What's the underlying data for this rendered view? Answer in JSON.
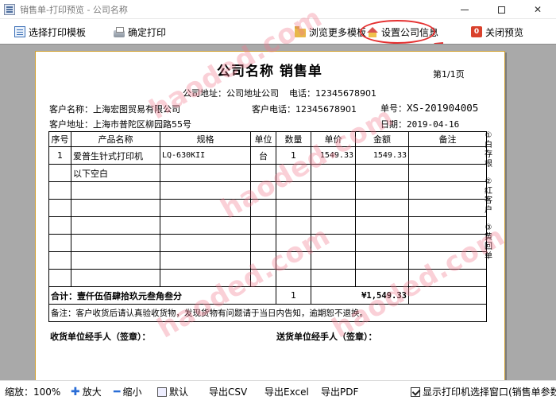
{
  "window": {
    "title": "销售单-打印预览 - 公司名称"
  },
  "toolbar": {
    "select_template": "选择打印模板",
    "confirm_print": "确定打印",
    "browse_templates": "浏览更多模板",
    "company_settings": "设置公司信息",
    "close_preview": "关闭预览"
  },
  "document": {
    "title": "公司名称  销售单",
    "page": "第1/1页",
    "company_address": "公司地址：公司地址公司",
    "company_phone": "电话：12345678901",
    "customer_name_label": "客户名称：",
    "customer_name": "上海宏图贸易有限公司",
    "customer_phone": "客户电话：12345678901",
    "order_no_label": "单号：",
    "order_no": "XS-201904005",
    "customer_addr_label": "客户地址：",
    "customer_addr": "上海市普陀区柳园路55号",
    "date_label": "日期：",
    "date": "2019-04-16",
    "columns": [
      "序号",
      "产品名称",
      "规格",
      "单位",
      "数量",
      "单价",
      "金额",
      "备注"
    ],
    "rows": [
      {
        "no": "1",
        "name": "爱普生针式打印机",
        "spec": "LQ-630KII",
        "unit": "台",
        "qty": "1",
        "price": "1549.33",
        "amount": "1549.33",
        "note": ""
      }
    ],
    "blank_note": "以下空白",
    "total_label": "合计：",
    "total_words": "壹仟伍佰肆拾玖元叁角叁分",
    "total_qty": "1",
    "total_amount": "¥1,549.33",
    "remark": "备注：客户收货后请认真验收货物，发现货物有问题请于当日内告知，逾期恕不退换。",
    "receiver_sign": "收货单位经手人（签章）：",
    "sender_sign": "送货单位经手人（签章）：",
    "side_notes": [
      "①白存根",
      "②红客户",
      "③黄回单"
    ],
    "watermark": "haoded.com"
  },
  "statusbar": {
    "zoom": "缩放：100%",
    "zoom_in": "放大",
    "zoom_out": "缩小",
    "default": "默认",
    "export_csv": "导出CSV",
    "export_excel": "导出Excel",
    "export_pdf": "导出PDF",
    "show_printer_dialog": "显示打印机选择窗口(销售单参数)"
  },
  "colors": {
    "annotation_red": "#e53030",
    "paper_border": "#d0a030",
    "preview_bg": "#a9a9a9"
  }
}
